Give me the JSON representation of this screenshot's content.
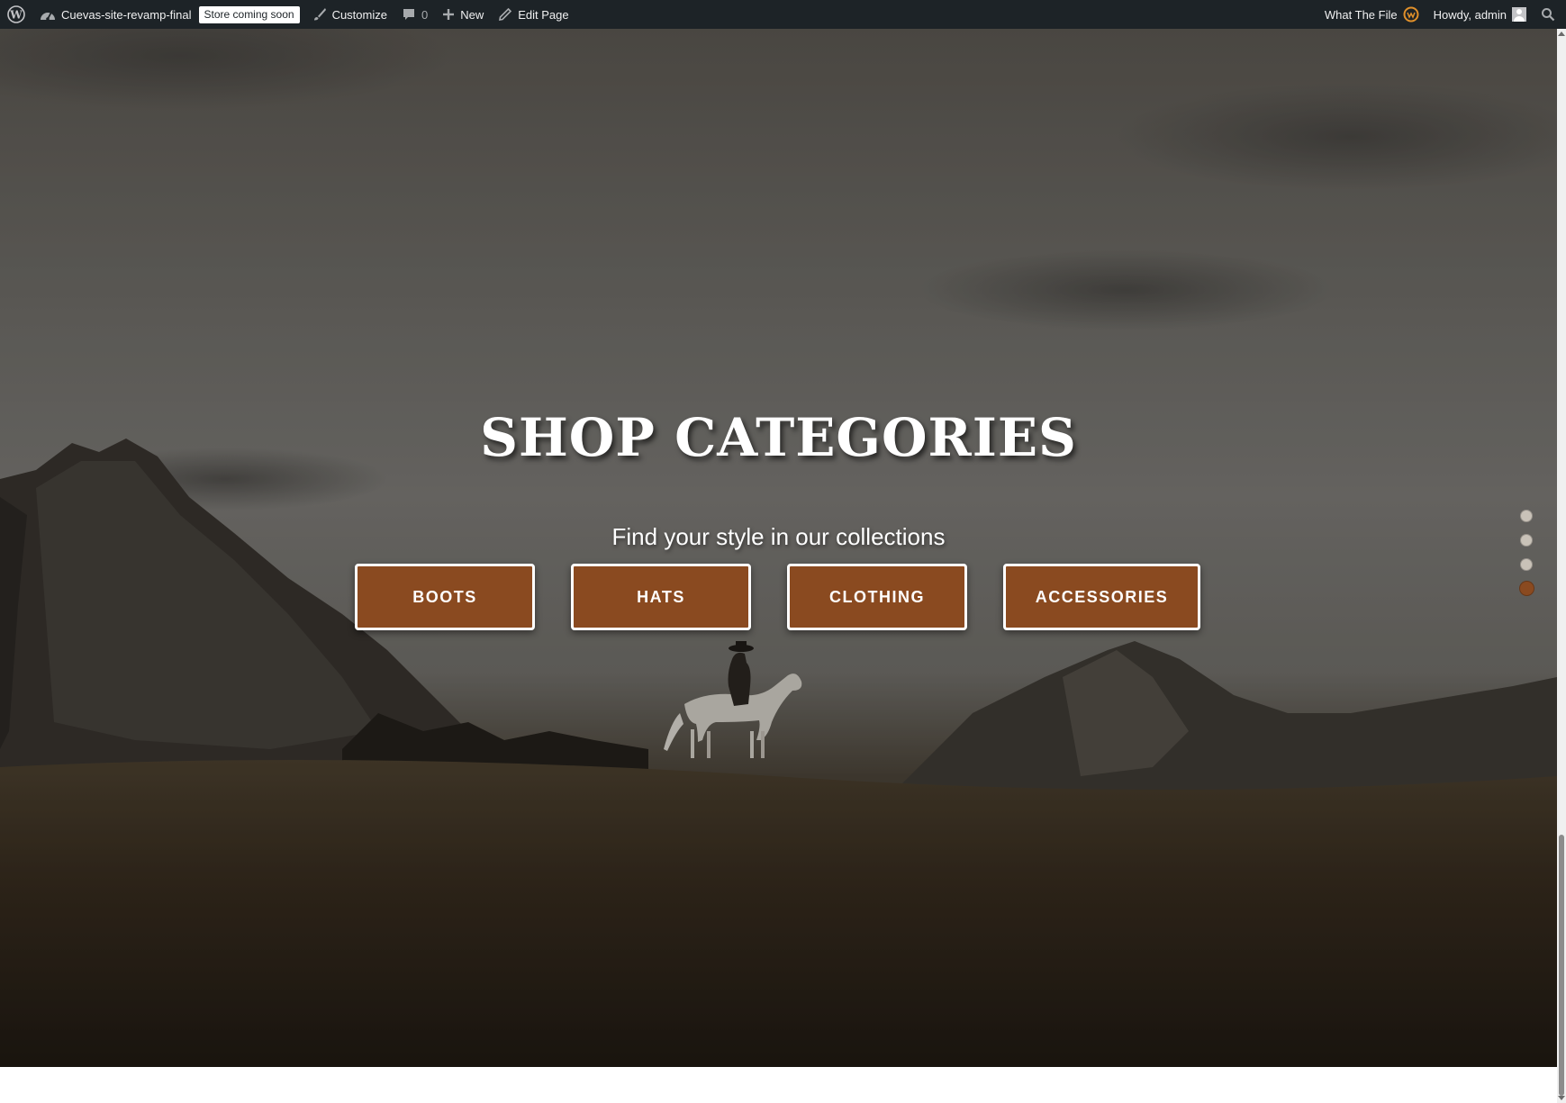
{
  "admin_bar": {
    "site_name": "Cuevas-site-revamp-final",
    "store_badge": "Store coming soon",
    "customize": "Customize",
    "comments_count": "0",
    "new": "New",
    "edit_page": "Edit Page",
    "plugin": "What The File",
    "greeting": "Howdy, admin"
  },
  "hero": {
    "title": "SHOP CATEGORIES",
    "subtitle": "Find your style in our collections",
    "buttons": [
      "BOOTS",
      "HATS",
      "CLOTHING",
      "ACCESSORIES"
    ],
    "section_dots": {
      "count": 4,
      "active_index": 3
    }
  },
  "colors": {
    "accent": "#8a4a20",
    "admin_bar_bg": "#1d2327",
    "text_on_dark": "#ffffff"
  },
  "icons": [
    "wordpress-logo-icon",
    "dashboard-icon",
    "paintbrush-icon",
    "comment-icon",
    "plus-icon",
    "pencil-icon",
    "wtf-plugin-icon",
    "avatar-icon",
    "search-icon"
  ]
}
